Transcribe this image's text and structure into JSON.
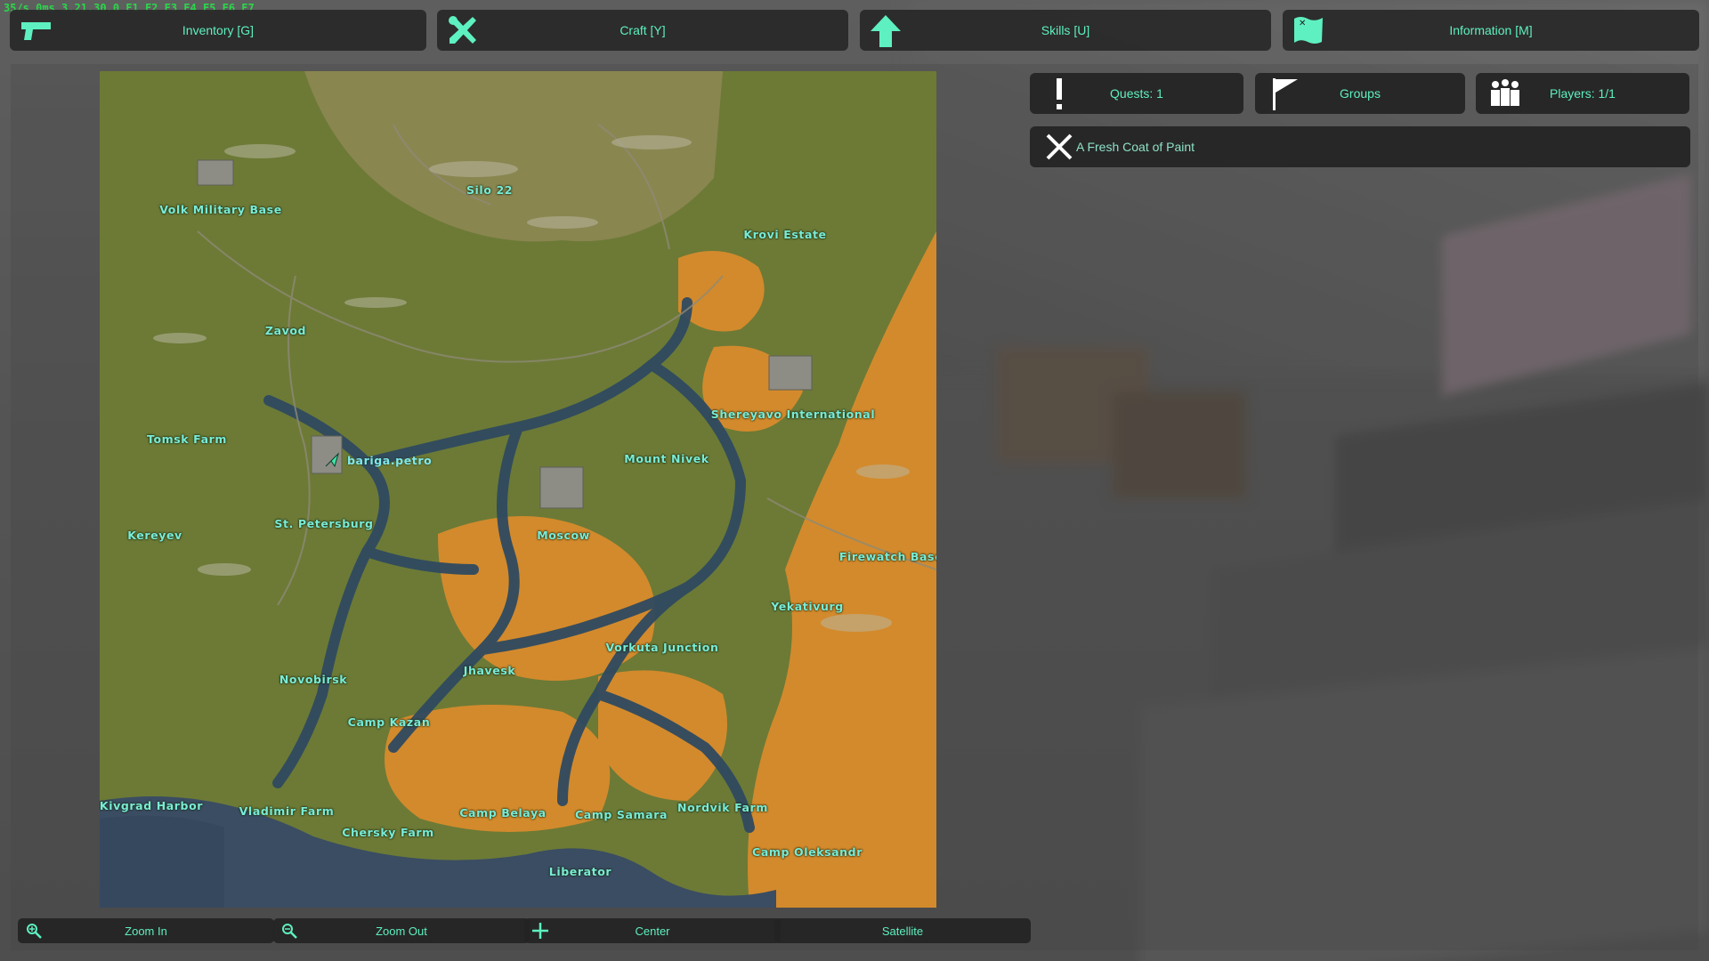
{
  "debug_text": "35/s 0ms 3.21.30.0 F1 F2 F3 F4 F5 F6 F7",
  "colors": {
    "accent": "#5ef0c0",
    "debug": "#2bd64a",
    "panel": "#282828"
  },
  "top_tabs": [
    {
      "label": "Inventory [G]",
      "icon": "pistol-icon"
    },
    {
      "label": "Craft [Y]",
      "icon": "crossed-tools-icon"
    },
    {
      "label": "Skills [U]",
      "icon": "arrow-up-icon"
    },
    {
      "label": "Information [M]",
      "icon": "map-icon"
    }
  ],
  "side_tabs": [
    {
      "label": "Quests: 1",
      "icon": "exclamation-icon"
    },
    {
      "label": "Groups",
      "icon": "flag-icon"
    },
    {
      "label": "Players: 1/1",
      "icon": "players-icon"
    }
  ],
  "quest": {
    "title": "A Fresh Coat of Paint",
    "icon": "close-x-icon"
  },
  "map": {
    "player_name": "bariga.petro",
    "locations": [
      "Volk Military Base",
      "Silo 22",
      "Krovi Estate",
      "Zavod",
      "Shereyavo International",
      "Tomsk Farm",
      "St. Petersburg",
      "Mount Nivek",
      "Moscow",
      "Kereyev",
      "Firewatch Base",
      "Yekativurg",
      "Vorkuta Junction",
      "Jhavesk",
      "Novobirsk",
      "Camp Kazan",
      "Kivgrad Harbor",
      "Vladimir Farm",
      "Camp Belaya",
      "Camp Samara",
      "Nordvik Farm",
      "Chersky Farm",
      "Camp Oleksandr",
      "Liberator"
    ]
  },
  "bottom_buttons": [
    {
      "label": "Zoom In",
      "icon": "zoom-in-icon"
    },
    {
      "label": "Zoom Out",
      "icon": "zoom-out-icon"
    },
    {
      "label": "Center",
      "icon": "plus-icon"
    },
    {
      "label": "Satellite",
      "icon": ""
    }
  ]
}
